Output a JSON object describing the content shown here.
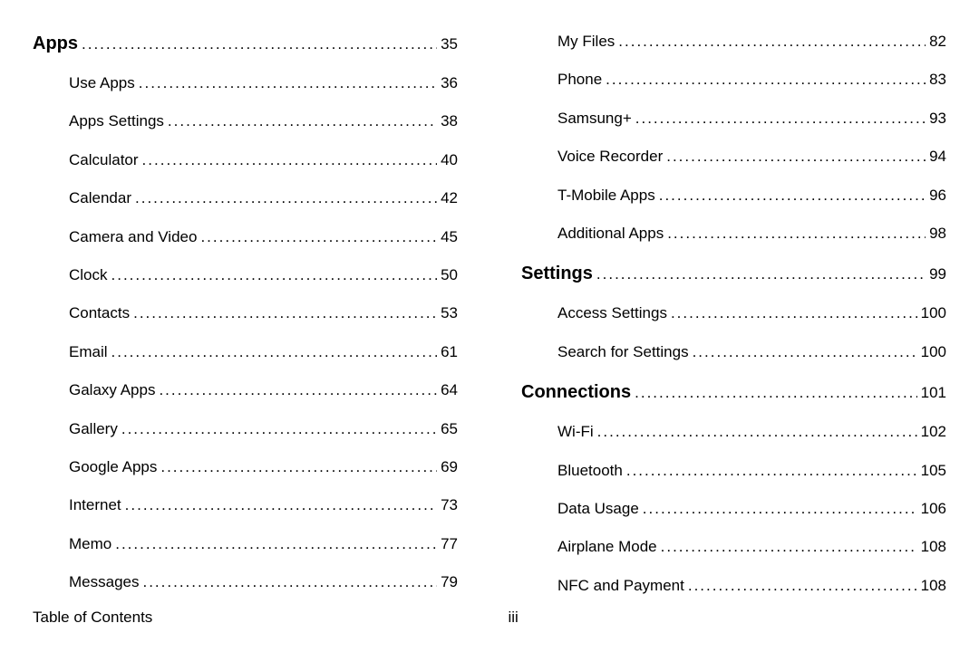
{
  "footer": {
    "label": "Table of Contents",
    "page": "iii"
  },
  "left": [
    {
      "title": "Apps",
      "page": "35",
      "level": 0,
      "bold": true
    },
    {
      "title": "Use Apps",
      "page": "36",
      "level": 1,
      "bold": false
    },
    {
      "title": "Apps Settings",
      "page": "38",
      "level": 1,
      "bold": false
    },
    {
      "title": "Calculator",
      "page": "40",
      "level": 1,
      "bold": false
    },
    {
      "title": "Calendar",
      "page": "42",
      "level": 1,
      "bold": false
    },
    {
      "title": "Camera and Video",
      "page": "45",
      "level": 1,
      "bold": false
    },
    {
      "title": "Clock",
      "page": "50",
      "level": 1,
      "bold": false
    },
    {
      "title": "Contacts",
      "page": "53",
      "level": 1,
      "bold": false
    },
    {
      "title": "Email",
      "page": "61",
      "level": 1,
      "bold": false
    },
    {
      "title": "Galaxy Apps",
      "page": "64",
      "level": 1,
      "bold": false
    },
    {
      "title": "Gallery",
      "page": "65",
      "level": 1,
      "bold": false
    },
    {
      "title": "Google Apps",
      "page": "69",
      "level": 1,
      "bold": false
    },
    {
      "title": "Internet",
      "page": "73",
      "level": 1,
      "bold": false
    },
    {
      "title": "Memo",
      "page": "77",
      "level": 1,
      "bold": false
    },
    {
      "title": "Messages",
      "page": "79",
      "level": 1,
      "bold": false
    }
  ],
  "right": [
    {
      "title": "My Files",
      "page": "82",
      "level": 1,
      "bold": false
    },
    {
      "title": "Phone",
      "page": "83",
      "level": 1,
      "bold": false
    },
    {
      "title": "Samsung+",
      "page": "93",
      "level": 1,
      "bold": false
    },
    {
      "title": "Voice Recorder",
      "page": "94",
      "level": 1,
      "bold": false
    },
    {
      "title": "T-Mobile Apps",
      "page": "96",
      "level": 1,
      "bold": false
    },
    {
      "title": "Additional Apps",
      "page": "98",
      "level": 1,
      "bold": false
    },
    {
      "title": "Settings",
      "page": "99",
      "level": 0,
      "bold": true
    },
    {
      "title": "Access Settings",
      "page": "100",
      "level": 1,
      "bold": false
    },
    {
      "title": "Search for Settings",
      "page": "100",
      "level": 1,
      "bold": false
    },
    {
      "title": "Connections",
      "page": "101",
      "level": 0,
      "bold": true,
      "subheading": true
    },
    {
      "title": "Wi-Fi",
      "page": "102",
      "level": 1,
      "bold": false
    },
    {
      "title": "Bluetooth",
      "page": "105",
      "level": 1,
      "bold": false
    },
    {
      "title": "Data Usage",
      "page": "106",
      "level": 1,
      "bold": false
    },
    {
      "title": "Airplane Mode",
      "page": "108",
      "level": 1,
      "bold": false
    },
    {
      "title": "NFC and Payment",
      "page": "108",
      "level": 1,
      "bold": false
    }
  ]
}
